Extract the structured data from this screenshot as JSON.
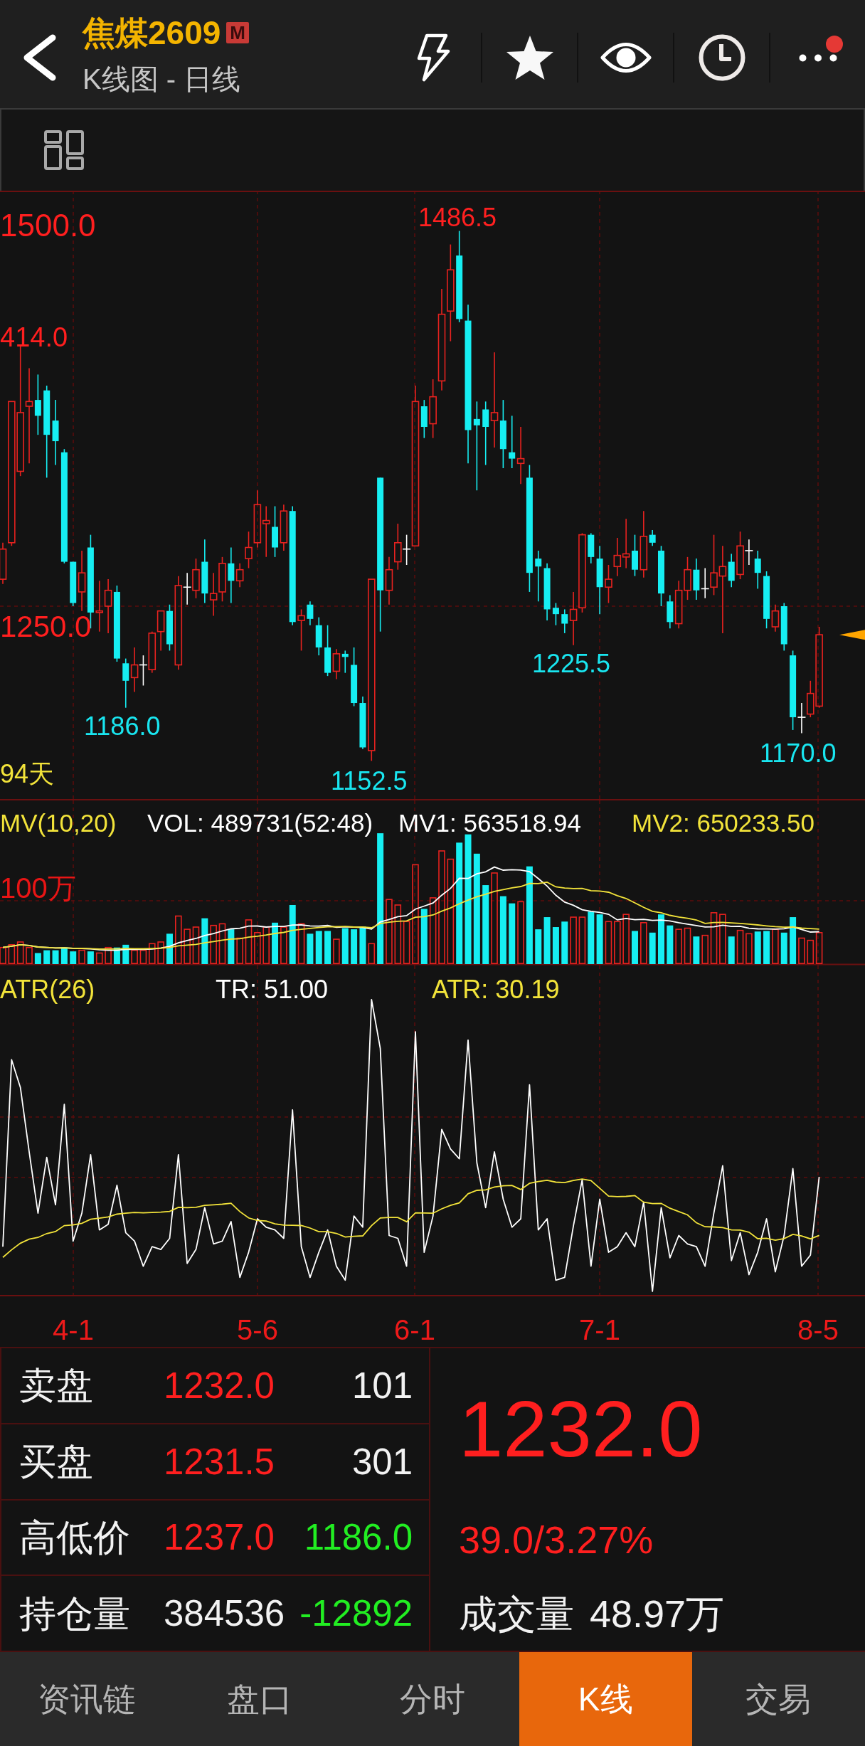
{
  "header": {
    "title": "焦煤2609",
    "badge": "M",
    "subtitle": "K线图 - 日线",
    "notification_dot": true
  },
  "price_chart": {
    "axis_labels": [
      "1500.0",
      "414.0",
      "1250.0"
    ],
    "period": "94天",
    "extremes": [
      {
        "text": "1486.5",
        "kind": "high"
      },
      {
        "text": "1225.5",
        "kind": "low"
      },
      {
        "text": "1186.0",
        "kind": "low"
      },
      {
        "text": "1170.0",
        "kind": "low"
      },
      {
        "text": "1152.5",
        "kind": "low"
      }
    ]
  },
  "volume_panel": {
    "readings": [
      {
        "text": "MV(10,20)",
        "color": "#f2e33a"
      },
      {
        "text": "VOL: 489731(52:48)",
        "color": "#ffffff"
      },
      {
        "text": "MV1: 563518.94",
        "color": "#ffffff"
      },
      {
        "text": "MV2: 650233.50",
        "color": "#f2e33a"
      }
    ],
    "scale_label": "100万"
  },
  "atr_panel": {
    "readings": [
      {
        "text": "ATR(26)",
        "color": "#f2e33a"
      },
      {
        "text": "TR: 51.00",
        "color": "#ffffff"
      },
      {
        "text": "ATR: 30.19",
        "color": "#f2e33a"
      }
    ]
  },
  "date_axis": [
    "4-1",
    "5-6",
    "6-1",
    "7-1",
    "8-5"
  ],
  "quote_table": {
    "rows": [
      {
        "label": "卖盘",
        "values": [
          {
            "text": "1232.0",
            "color": "#ff1f1f"
          },
          {
            "text": "101",
            "color": "#f2f2f2"
          }
        ]
      },
      {
        "label": "买盘",
        "values": [
          {
            "text": "1231.5",
            "color": "#ff1f1f"
          },
          {
            "text": "301",
            "color": "#f2f2f2"
          }
        ]
      },
      {
        "label": "高低价",
        "values": [
          {
            "text": "1237.0",
            "color": "#ff1f1f"
          },
          {
            "text": "1186.0",
            "color": "#22ee22"
          }
        ]
      },
      {
        "label": "持仓量",
        "values": [
          {
            "text": "384536",
            "color": "#f2f2f2"
          },
          {
            "text": "-12892",
            "color": "#22ee22"
          }
        ]
      }
    ]
  },
  "quote_summary": {
    "last_price": {
      "text": "1232.0",
      "color": "#ff1f1f"
    },
    "change": {
      "text": "39.0/3.27%",
      "color": "#ff1f1f"
    },
    "volume_label": "成交量",
    "volume_value": "48.97万"
  },
  "tabs": [
    {
      "label": "资讯链",
      "selected": false
    },
    {
      "label": "盘口",
      "selected": false
    },
    {
      "label": "分时",
      "selected": false
    },
    {
      "label": "K线",
      "selected": true
    },
    {
      "label": "交易",
      "selected": false
    }
  ]
}
